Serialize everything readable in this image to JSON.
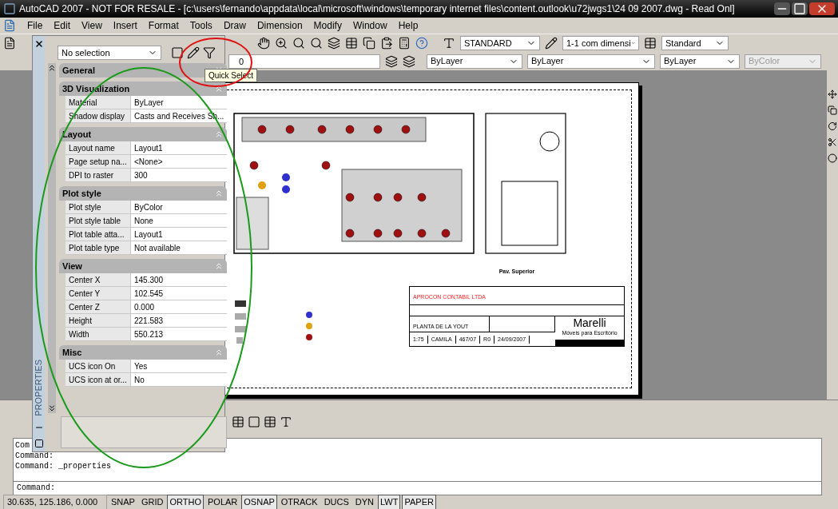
{
  "window": {
    "title": "AutoCAD 2007 - NOT FOR RESALE - [c:\\users\\fernando\\appdata\\local\\microsoft\\windows\\temporary internet files\\content.outlook\\u72jwgs1\\24 09 2007.dwg - Read Onl]"
  },
  "menu": [
    "File",
    "Edit",
    "View",
    "Insert",
    "Format",
    "Tools",
    "Draw",
    "Dimension",
    "Modify",
    "Window",
    "Help"
  ],
  "toolbar": {
    "text_style": "STANDARD",
    "dim_style": "1-1 com dimensi",
    "table_style": "Standard",
    "layer": "0",
    "color_control": "ByLayer",
    "linetype": "ByLayer",
    "lineweight": "ByLayer",
    "plot_style": {
      "value": "ByColor",
      "disabled": true
    }
  },
  "tooltip": "Quick Select",
  "properties": {
    "selection": "No selection",
    "palette_title": "PROPERTIES",
    "sections": [
      {
        "title": "General",
        "expanded": false
      },
      {
        "title": "3D Visualization",
        "expanded": true,
        "rows": [
          {
            "label": "Material",
            "value": "ByLayer"
          },
          {
            "label": "Shadow display",
            "value": "Casts and Receives Sh..."
          }
        ]
      },
      {
        "title": "Layout",
        "expanded": true,
        "rows": [
          {
            "label": "Layout name",
            "value": "Layout1"
          },
          {
            "label": "Page setup na...",
            "value": "<None>"
          },
          {
            "label": "DPI to raster",
            "value": "300"
          }
        ]
      },
      {
        "title": "Plot style",
        "expanded": true,
        "rows": [
          {
            "label": "Plot style",
            "value": "ByColor"
          },
          {
            "label": "Plot style table",
            "value": "None"
          },
          {
            "label": "Plot table atta...",
            "value": "Layout1"
          },
          {
            "label": "Plot table type",
            "value": "Not available"
          }
        ]
      },
      {
        "title": "View",
        "expanded": true,
        "rows": [
          {
            "label": "Center X",
            "value": "145.300"
          },
          {
            "label": "Center Y",
            "value": "102.545"
          },
          {
            "label": "Center Z",
            "value": "0.000"
          },
          {
            "label": "Height",
            "value": "221.583"
          },
          {
            "label": "Width",
            "value": "550.213"
          }
        ]
      },
      {
        "title": "Misc",
        "expanded": true,
        "rows": [
          {
            "label": "UCS icon On",
            "value": "Yes"
          },
          {
            "label": "UCS icon at or...",
            "value": "No"
          }
        ]
      }
    ]
  },
  "drawing": {
    "floor_label": "Pav. Superior",
    "title_block": {
      "client": "APROCON CONTABIL LTDA",
      "sheet": "PLANTA DE LA YOUT",
      "scale": "1:75",
      "author": "CAMILA",
      "number": "467/07",
      "revision": "R0",
      "date": "24/09/2007",
      "brand": "Marelli",
      "brand_tagline": "Móveis para Escritório"
    }
  },
  "command_window": {
    "lines": [
      "Com",
      "Command:",
      "Command: _properties"
    ],
    "prompt": "Command:"
  },
  "status_bar": {
    "coordinates": "30.635, 125.186, 0.000",
    "toggles": [
      {
        "label": "SNAP",
        "on": false
      },
      {
        "label": "GRID",
        "on": false
      },
      {
        "label": "ORTHO",
        "on": true
      },
      {
        "label": "POLAR",
        "on": false
      },
      {
        "label": "OSNAP",
        "on": true
      },
      {
        "label": "OTRACK",
        "on": false
      },
      {
        "label": "DUCS",
        "on": false
      },
      {
        "label": "DYN",
        "on": false
      },
      {
        "label": "LWT",
        "on": true
      },
      {
        "label": "PAPER",
        "on": true
      }
    ]
  }
}
